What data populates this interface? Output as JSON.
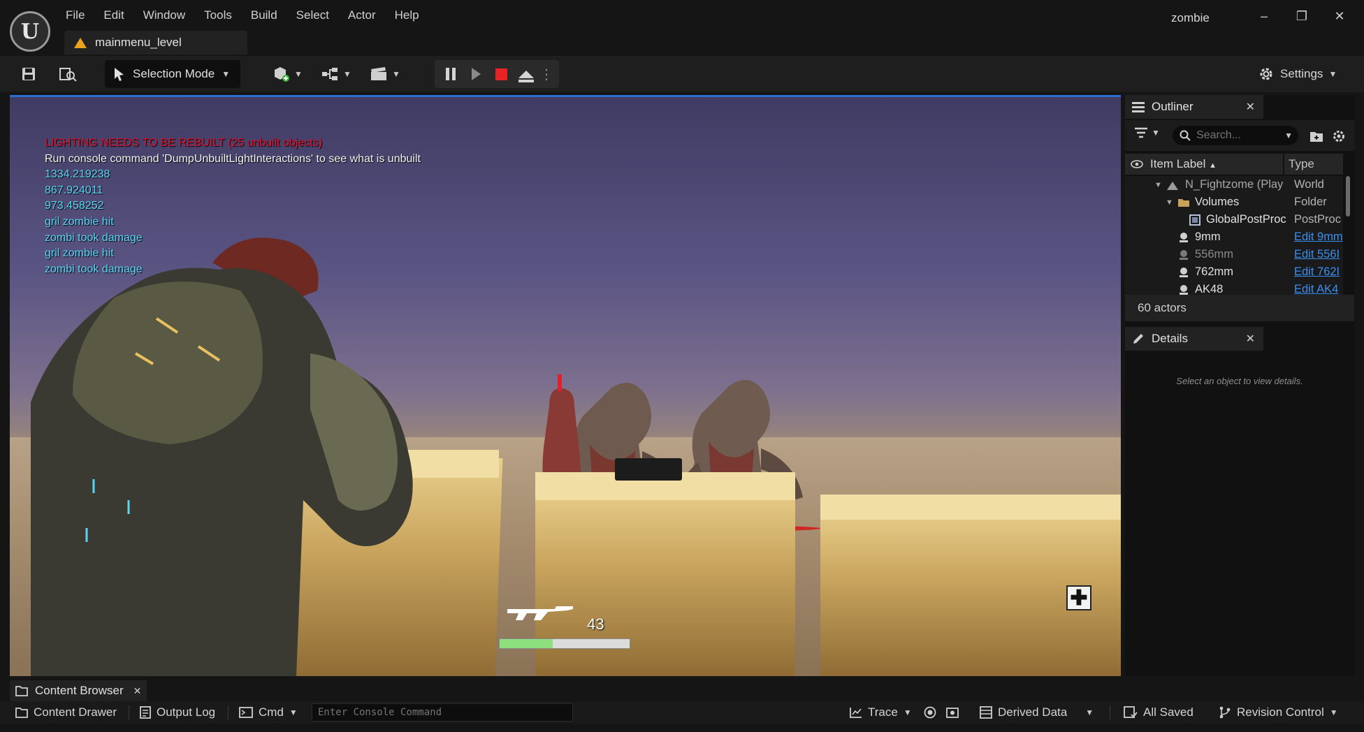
{
  "window": {
    "menu": [
      "File",
      "Edit",
      "Window",
      "Tools",
      "Build",
      "Select",
      "Actor",
      "Help"
    ],
    "document_tab": "mainmenu_level",
    "project_name": "zombie",
    "controls": {
      "minimize": "–",
      "restore": "❐",
      "close": "✕"
    }
  },
  "toolbar": {
    "mode_label": "Selection Mode",
    "settings_label": "Settings"
  },
  "viewport": {
    "debug_lines": {
      "warning": "LIGHTING NEEDS TO BE REBUILT (25 unbuilt objects)",
      "hint": "Run console command 'DumpUnbuiltLightInteractions' to see what is unbuilt",
      "log": [
        "1334.219238",
        "867.924011",
        "973.458252",
        "gril zombie hit",
        "zombi took damage",
        "gril zombie hit",
        "zombi took damage"
      ]
    },
    "hud": {
      "ammo": "43",
      "health_fraction": 0.41
    },
    "colors": {
      "warning": "#e0112c",
      "log": "#58d7f3",
      "health": "#8ee07e"
    }
  },
  "outliner": {
    "tab_label": "Outliner",
    "search_placeholder": "Search...",
    "col_item_label": "Item Label",
    "col_type": "Type",
    "rows": [
      {
        "name": "N_Fightzome (Play",
        "type": "World"
      },
      {
        "name": "Volumes",
        "type": "Folder"
      },
      {
        "name": "GlobalPostProc",
        "type": "PostProc"
      },
      {
        "name": "9mm",
        "type": "Edit 9mm"
      },
      {
        "name": "556mm",
        "type": "Edit 556I"
      },
      {
        "name": "762mm",
        "type": "Edit 762I"
      },
      {
        "name": "AK48",
        "type": "Edit AK4"
      }
    ],
    "actor_count": "60 actors"
  },
  "details": {
    "tab_label": "Details",
    "empty_message": "Select an object to view details."
  },
  "bottom": {
    "content_browser_tab": "Content Browser",
    "content_drawer": "Content Drawer",
    "output_log": "Output Log",
    "cmd": "Cmd",
    "console_placeholder": "Enter Console Command",
    "trace": "Trace",
    "derived_data": "Derived Data",
    "all_saved": "All Saved",
    "revision_control": "Revision Control"
  }
}
